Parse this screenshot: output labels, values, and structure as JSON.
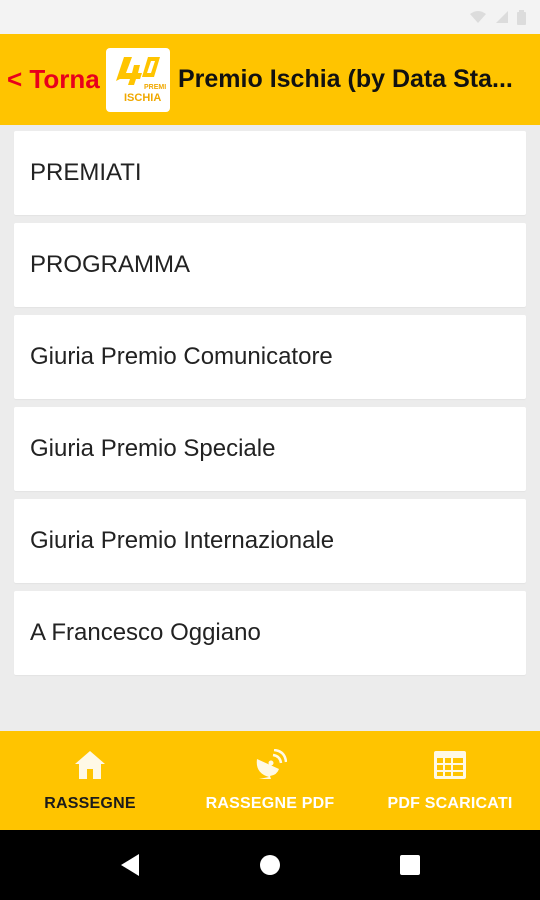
{
  "header": {
    "back_label": "< Torna",
    "title": "Premio Ischia (by Data Sta...",
    "logo_text_top": "40",
    "logo_text_mid": "PREMIO",
    "logo_text_bottom": "ISCHIA"
  },
  "list": {
    "items": [
      {
        "label": "PREMIATI"
      },
      {
        "label": "PROGRAMMA"
      },
      {
        "label": "Giuria Premio Comunicatore"
      },
      {
        "label": "Giuria Premio Speciale"
      },
      {
        "label": "Giuria Premio Internazionale"
      },
      {
        "label": "A Francesco Oggiano"
      }
    ]
  },
  "bottom_nav": {
    "items": [
      {
        "label": "RASSEGNE",
        "icon": "home-icon",
        "active": true
      },
      {
        "label": "RASSEGNE PDF",
        "icon": "satellite-dish-icon",
        "active": false
      },
      {
        "label": "PDF SCARICATI",
        "icon": "calendar-grid-icon",
        "active": false
      }
    ]
  },
  "colors": {
    "accent": "#ffc400",
    "back_text": "#e8001c",
    "background": "#ececec"
  }
}
